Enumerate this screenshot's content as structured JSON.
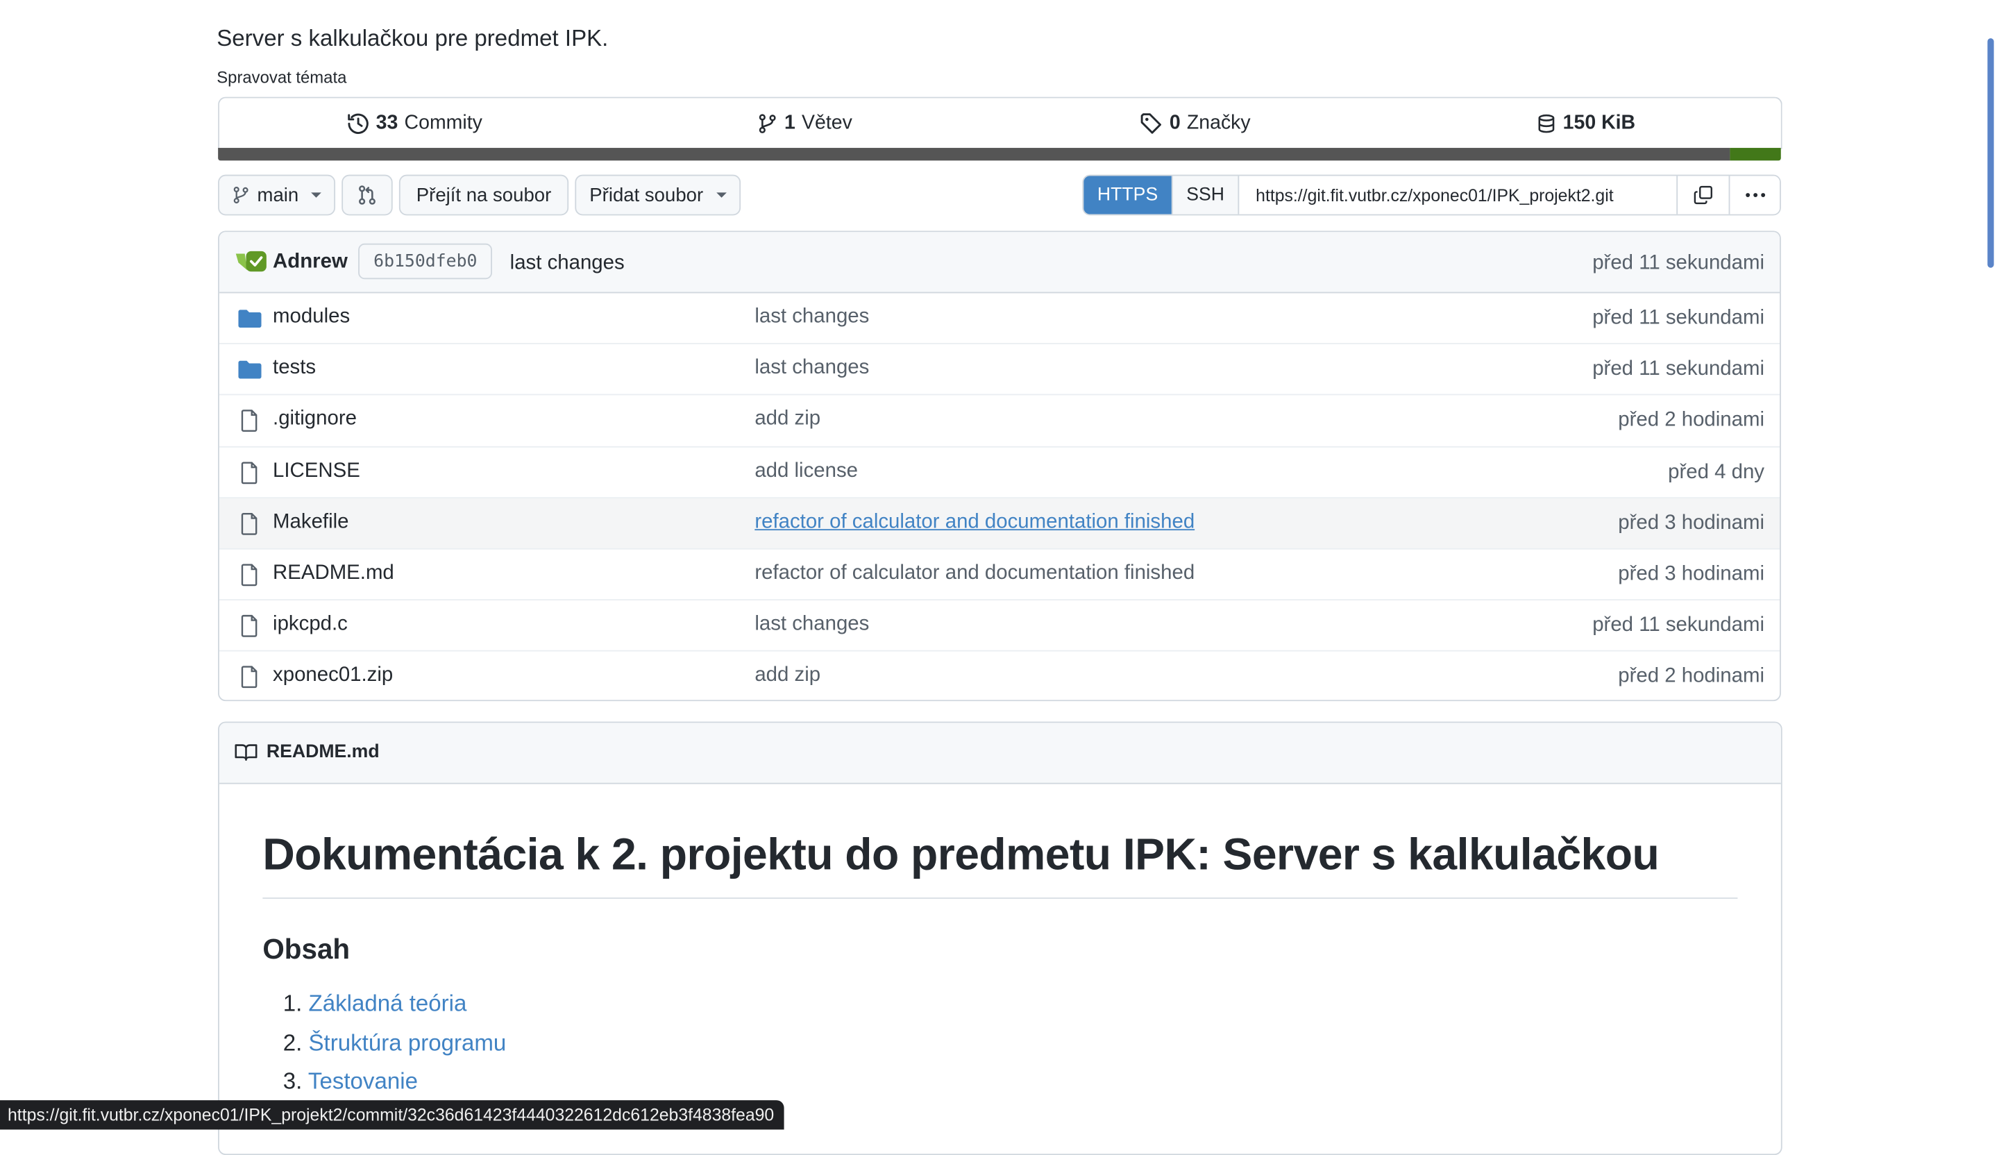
{
  "repo": {
    "description": "Server s kalkulačkou pre predmet IPK.",
    "manage_topics": "Spravovat témata"
  },
  "stats": {
    "commits_count": "33",
    "commits_label": "Commity",
    "branches_count": "1",
    "branches_label": "Větev",
    "tags_count": "0",
    "tags_label": "Značky",
    "size": "150 KiB"
  },
  "languages": {
    "colors": [
      "#555555",
      "#427819"
    ],
    "shares": [
      0.967,
      0.033
    ]
  },
  "toolbar": {
    "branch": "main",
    "goto_file": "Přejít na soubor",
    "add_file": "Přidat soubor",
    "https": "HTTPS",
    "ssh": "SSH",
    "clone_url": "https://git.fit.vutbr.cz/xponec01/IPK_projekt2.git"
  },
  "latest_commit": {
    "author": "Adnrew",
    "sha": "6b150dfeb0",
    "message": "last changes",
    "time": "před 11 sekundami"
  },
  "files": [
    {
      "icon": "folder-icon",
      "name": "modules",
      "message": "last changes",
      "time": "před 11 sekundami"
    },
    {
      "icon": "folder-icon",
      "name": "tests",
      "message": "last changes",
      "time": "před 11 sekundami"
    },
    {
      "icon": "file-icon",
      "name": ".gitignore",
      "message": "add zip",
      "time": "před 2 hodinami"
    },
    {
      "icon": "file-icon",
      "name": "LICENSE",
      "message": "add license",
      "time": "před 4 dny"
    },
    {
      "icon": "file-icon",
      "name": "Makefile",
      "message": "refactor of calculator and documentation finished",
      "time": "před 3 hodinami"
    },
    {
      "icon": "file-icon",
      "name": "README.md",
      "message": "refactor of calculator and documentation finished",
      "time": "před 3 hodinami"
    },
    {
      "icon": "file-icon",
      "name": "ipkcpd.c",
      "message": "last changes",
      "time": "před 11 sekundami"
    },
    {
      "icon": "file-icon",
      "name": "xponec01.zip",
      "message": "add zip",
      "time": "před 2 hodinami"
    }
  ],
  "readme": {
    "filename": "README.md",
    "h1": "Dokumentácia k 2. projektu do predmetu IPK: Server s kalkulačkou",
    "h2": "Obsah",
    "toc": [
      "Základná teória",
      "Štruktúra programu",
      "Testovanie"
    ]
  },
  "status_url": "https://git.fit.vutbr.cz/xponec01/IPK_projekt2/commit/32c36d61423f4440322612dc612eb3f4838fea90"
}
